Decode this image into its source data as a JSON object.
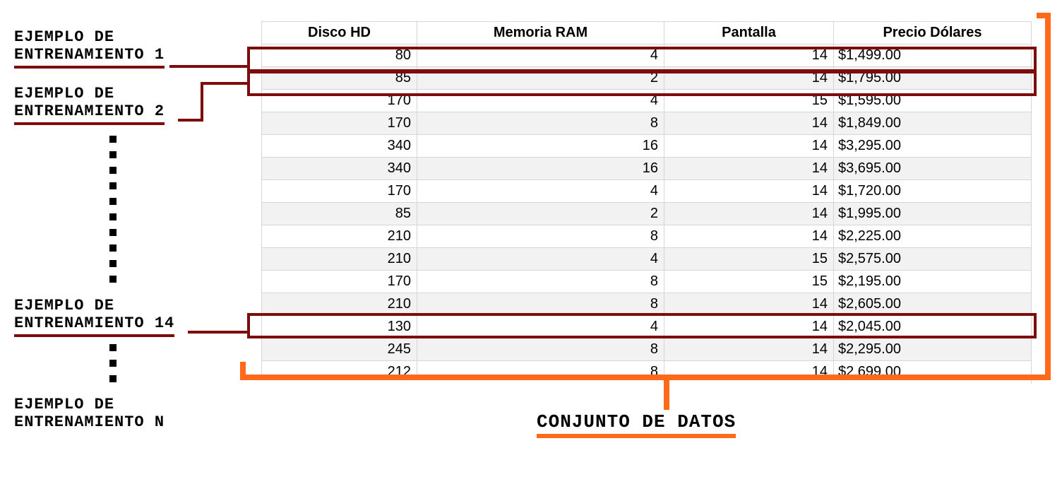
{
  "labels": {
    "ej1_l1": "EJEMPLO DE",
    "ej1_l2": "ENTRENAMIENTO 1",
    "ej2_l1": "EJEMPLO DE",
    "ej2_l2": "ENTRENAMIENTO 2",
    "ej14_l1": "EJEMPLO DE",
    "ej14_l2": "ENTRENAMIENTO 14",
    "ejn_l1": "EJEMPLO DE",
    "ejn_l2": "ENTRENAMIENTO N",
    "caption": "CONJUNTO DE DATOS"
  },
  "columns": {
    "c1": "Disco HD",
    "c2": "Memoria RAM",
    "c3": "Pantalla",
    "c4": "Precio Dólares"
  },
  "rows": [
    {
      "hd": "80",
      "ram": "4",
      "pant": "14",
      "precio": "$1,499.00"
    },
    {
      "hd": "85",
      "ram": "2",
      "pant": "14",
      "precio": "$1,795.00"
    },
    {
      "hd": "170",
      "ram": "4",
      "pant": "15",
      "precio": "$1,595.00"
    },
    {
      "hd": "170",
      "ram": "8",
      "pant": "14",
      "precio": "$1,849.00"
    },
    {
      "hd": "340",
      "ram": "16",
      "pant": "14",
      "precio": "$3,295.00"
    },
    {
      "hd": "340",
      "ram": "16",
      "pant": "14",
      "precio": "$3,695.00"
    },
    {
      "hd": "170",
      "ram": "4",
      "pant": "14",
      "precio": "$1,720.00"
    },
    {
      "hd": "85",
      "ram": "2",
      "pant": "14",
      "precio": "$1,995.00"
    },
    {
      "hd": "210",
      "ram": "8",
      "pant": "14",
      "precio": "$2,225.00"
    },
    {
      "hd": "210",
      "ram": "4",
      "pant": "15",
      "precio": "$2,575.00"
    },
    {
      "hd": "170",
      "ram": "8",
      "pant": "15",
      "precio": "$2,195.00"
    },
    {
      "hd": "210",
      "ram": "8",
      "pant": "14",
      "precio": "$2,605.00"
    },
    {
      "hd": "130",
      "ram": "4",
      "pant": "14",
      "precio": "$2,045.00"
    },
    {
      "hd": "245",
      "ram": "8",
      "pant": "14",
      "precio": "$2,295.00"
    },
    {
      "hd": "212",
      "ram": "8",
      "pant": "14",
      "precio": "$2,699.00"
    }
  ],
  "chart_data": {
    "type": "table",
    "title": "CONJUNTO DE DATOS",
    "columns": [
      "Disco HD",
      "Memoria RAM",
      "Pantalla",
      "Precio Dólares"
    ],
    "rows": [
      [
        80,
        4,
        14,
        1499.0
      ],
      [
        85,
        2,
        14,
        1795.0
      ],
      [
        170,
        4,
        15,
        1595.0
      ],
      [
        170,
        8,
        14,
        1849.0
      ],
      [
        340,
        16,
        14,
        3295.0
      ],
      [
        340,
        16,
        14,
        3695.0
      ],
      [
        170,
        4,
        14,
        1720.0
      ],
      [
        85,
        2,
        14,
        1995.0
      ],
      [
        210,
        8,
        14,
        2225.0
      ],
      [
        210,
        4,
        15,
        2575.0
      ],
      [
        170,
        8,
        15,
        2195.0
      ],
      [
        210,
        8,
        14,
        2605.0
      ],
      [
        130,
        4,
        14,
        2045.0
      ],
      [
        245,
        8,
        14,
        2295.0
      ],
      [
        212,
        8,
        14,
        2699.0
      ]
    ],
    "highlighted_rows": [
      0,
      1,
      13
    ],
    "highlight_labels": {
      "0": "EJEMPLO DE ENTRENAMIENTO 1",
      "1": "EJEMPLO DE ENTRENAMIENTO 2",
      "13": "EJEMPLO DE ENTRENAMIENTO 14"
    }
  }
}
